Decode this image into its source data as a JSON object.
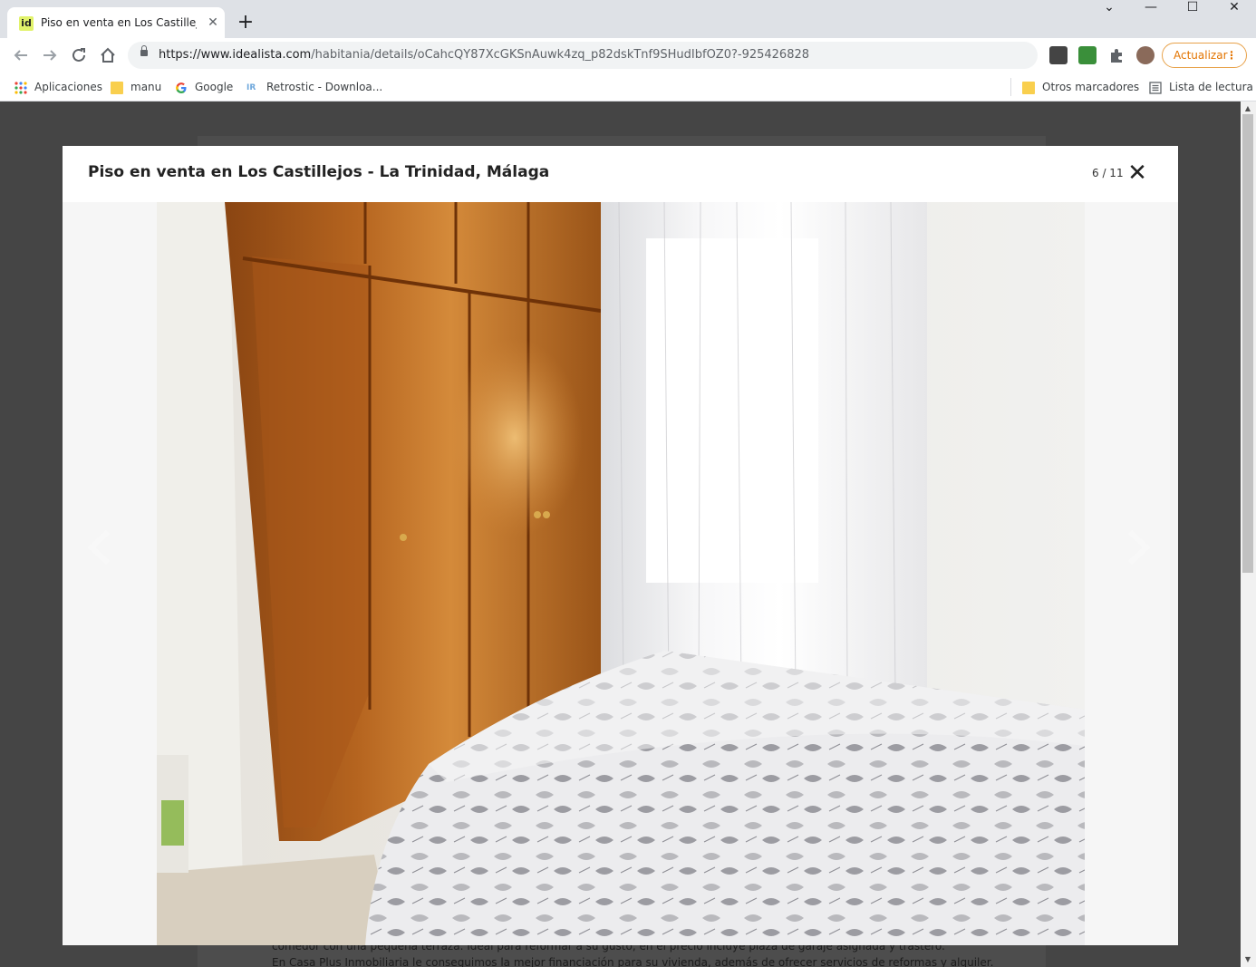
{
  "browser": {
    "tab_title": "Piso en venta en Los Castillejos -",
    "favicon_text": "id",
    "tab_close": "✕",
    "new_tab": "+",
    "window_controls": {
      "collapse": "⌄",
      "minimize": "—",
      "maximize": "☐",
      "close": "✕"
    },
    "url_host": "https://www.idealista.com",
    "url_path": "/habitania/details/oCahcQY87XcGKSnAuwk4zq_p82dskTnf9SHudIbfOZ0?-925426828",
    "update_label": "Actualizar",
    "update_menu": "⋮"
  },
  "bookmarks": {
    "apps": "Aplicaciones",
    "manu": "manu",
    "google": "Google",
    "retrostic": "Retrostic - Downloa...",
    "other": "Otros marcadores",
    "reading_list": "Lista de lectura"
  },
  "background_page": {
    "line1": "comedor con una pequeña terraza. Ideal para reformar a su gusto, en el precio incluye plaza de garaje asignada y trastero.",
    "line2": "En Casa Plus Inmobiliaria le conseguimos la mejor financiación para su vivienda, además de ofrecer servicios de reformas y alquiler."
  },
  "modal": {
    "title": "Piso en venta en Los Castillejos - La Trinidad, Málaga",
    "counter": "6 / 11",
    "close": "✕"
  },
  "colors": {
    "accent_update": "#e37400",
    "favicon": "#e1f26b",
    "folder": "#f9cf4e"
  }
}
